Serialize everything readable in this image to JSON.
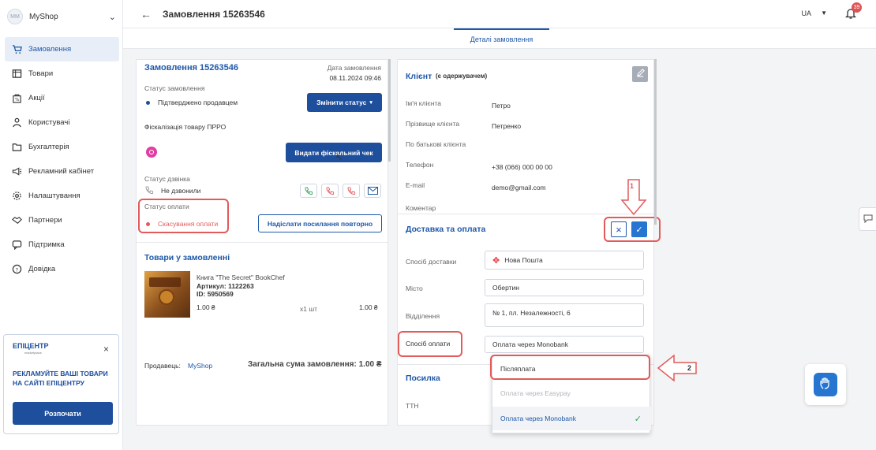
{
  "shop": {
    "avatar_text": "MM",
    "name": "MyShop"
  },
  "sidebar": {
    "items": [
      {
        "label": "Замовлення"
      },
      {
        "label": "Товари"
      },
      {
        "label": "Акції"
      },
      {
        "label": "Користувачі"
      },
      {
        "label": "Бухгалтерія"
      },
      {
        "label": "Рекламний кабінет"
      },
      {
        "label": "Налаштування"
      },
      {
        "label": "Партнери"
      },
      {
        "label": "Підтримка"
      },
      {
        "label": "Довідка"
      }
    ]
  },
  "promo": {
    "logo": "ЕПІЦЕНТР",
    "logo_sub": "marketplace",
    "text": "РЕКЛАМУЙТЕ ВАШІ ТОВАРИ НА САЙТІ ЕПІЦЕНТРУ",
    "button": "Розпочати"
  },
  "header": {
    "title": "Замовлення 15263546",
    "lang": "UA",
    "notifications": "39"
  },
  "tabs": {
    "details": "Деталі замовлення"
  },
  "order": {
    "title": "Замовлення 15263546",
    "date_label": "Дата замовлення",
    "date": "08.11.2024 09:46",
    "status_label": "Статус замовлення",
    "status": "Підтверджено продавцем",
    "change_status": "Змінити статус",
    "fiscal_label": "Фіскалізація товару ПРРО",
    "fiscal_button": "Видати фіскальний чек",
    "call_status_label": "Статус дзвінка",
    "call_status": "Не дзвонили",
    "payment_status_label": "Статус оплати",
    "payment_status": "Скасування оплати",
    "resend_link": "Надіслати посилання повторно",
    "goods_title": "Товари у замовленні",
    "product_name": "Книга \"The Secret\" BookChef",
    "product_article": "Артикул: 1122263",
    "product_id": "ID: 5950569",
    "product_price": "1.00 ₴",
    "product_qty": "x1 шт",
    "product_total": "1.00 ₴",
    "seller_label": "Продавець:",
    "seller": "MyShop",
    "order_total": "Загальна сума замовлення: 1.00 ₴"
  },
  "client": {
    "title": "Клієнт",
    "subtitle": "(є одержувачем)",
    "fields": [
      {
        "label": "Ім'я клієнта",
        "value": "Петро"
      },
      {
        "label": "Прізвище клієнта",
        "value": "Петренко"
      },
      {
        "label": "По батькові клієнта",
        "value": ""
      },
      {
        "label": "Телефон",
        "value": "+38 (066) 000 00 00"
      },
      {
        "label": "E-mail",
        "value": "demo@gmail.com"
      },
      {
        "label": "Коментар",
        "value": ""
      }
    ]
  },
  "delivery": {
    "title": "Доставка та оплата",
    "method_label": "Спосіб доставки",
    "method": "Нова Пошта",
    "city_label": "Місто",
    "city": "Обертин",
    "branch_label": "Відділення",
    "branch": "№ 1, пл. Незалежності, 6",
    "payment_label": "Спосіб оплати",
    "payment": "Оплата через Monobank"
  },
  "parcel": {
    "title": "Посилка",
    "ttn_label": "ТТН"
  },
  "dropdown": {
    "options": [
      {
        "label": "Післяплата"
      },
      {
        "label": "Оплата через Easypay"
      },
      {
        "label": "Оплата через Monobank"
      }
    ]
  },
  "annotations": {
    "one": "1",
    "two": "2"
  },
  "colors": {
    "brand": "#1d4f9c",
    "accent": "#1f58a8",
    "alert": "#e35a5a"
  }
}
